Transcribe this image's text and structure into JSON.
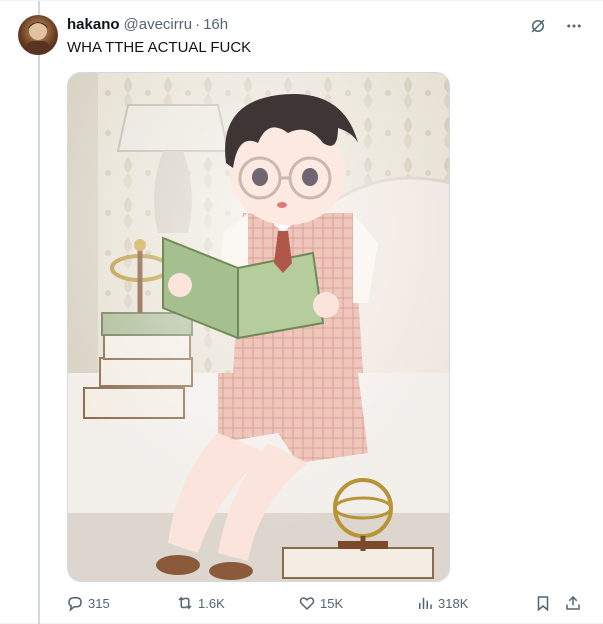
{
  "author": {
    "name": "hakano",
    "handle": "@avecirru",
    "separator": "·",
    "time": "16h",
    "avatar_icon": "user-avatar"
  },
  "tweet": {
    "text": "WHA TTHE ACTUAL FUCK"
  },
  "top_actions": [
    {
      "icon": "grok-icon"
    },
    {
      "icon": "more-icon"
    }
  ],
  "media": {
    "type": "illustration",
    "subject": "anime boy with glasses reading a green book on a bed"
  },
  "actions": {
    "reply_count": "315",
    "retweet_count": "1.6K",
    "like_count": "15K",
    "views_count": "318K"
  },
  "colors": {
    "text_primary": "#0f1419",
    "text_secondary": "#536471",
    "border": "#cfd9de"
  }
}
